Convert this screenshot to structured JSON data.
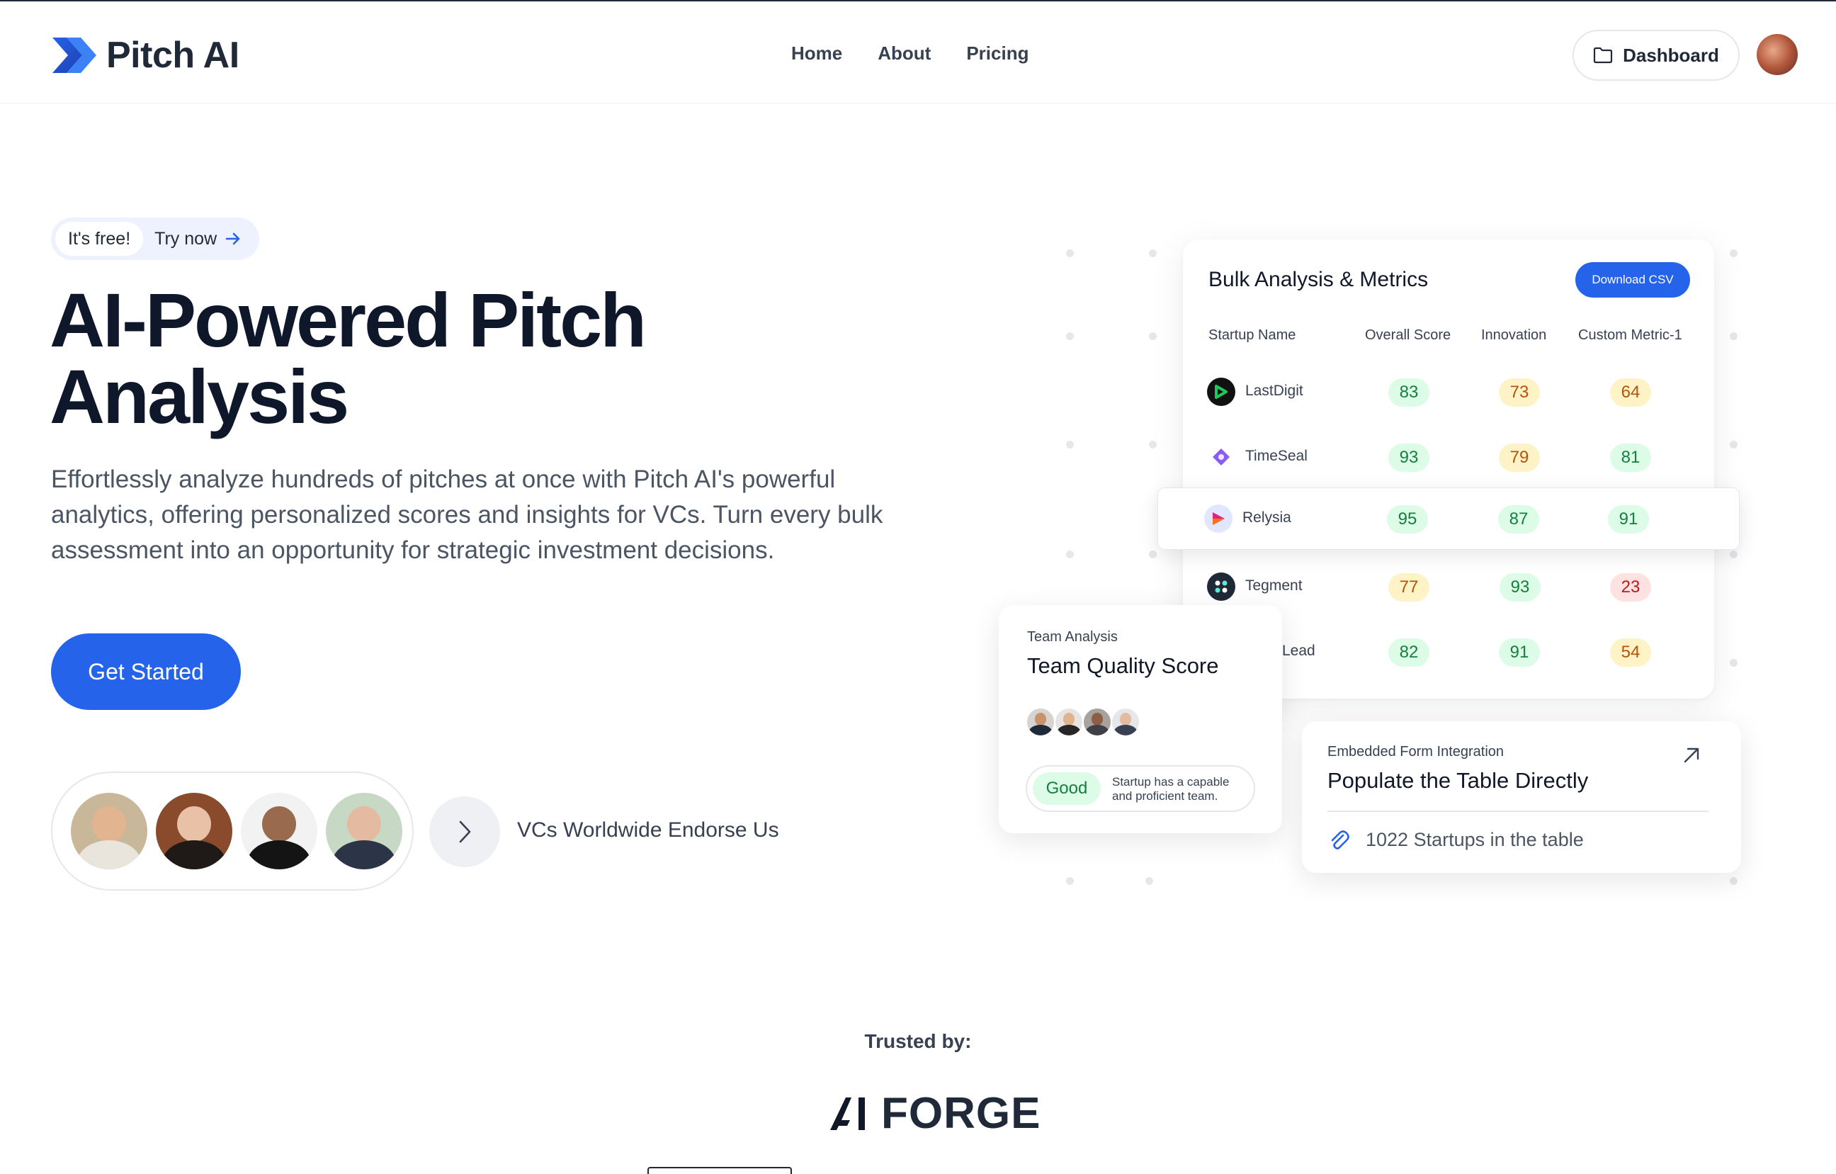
{
  "brand": {
    "name": "Pitch AI"
  },
  "nav": {
    "items": [
      "Home",
      "About",
      "Pricing"
    ],
    "dashboard": "Dashboard"
  },
  "hero": {
    "pill_free": "It's free!",
    "pill_try": "Try now",
    "title_line1": "AI-Powered Pitch",
    "title_line2": "Analysis",
    "description": "Effortlessly analyze hundreds of pitches at once with Pitch AI's powerful analytics, offering personalized scores and insights for VCs. Turn every bulk assessment into an opportunity for strategic investment decisions.",
    "cta": "Get Started",
    "endorse": "VCs Worldwide Endorse Us"
  },
  "metrics_card": {
    "title": "Bulk Analysis & Metrics",
    "download": "Download CSV",
    "columns": [
      "Startup Name",
      "Overall Score",
      "Innovation",
      "Custom Metric-1"
    ],
    "rows": [
      {
        "name": "LastDigit",
        "scores": [
          "83",
          "73",
          "64"
        ]
      },
      {
        "name": "TimeSeal",
        "scores": [
          "93",
          "79",
          "81"
        ]
      },
      {
        "name": "Relysia",
        "scores": [
          "95",
          "87",
          "91"
        ]
      },
      {
        "name": "Tegment",
        "scores": [
          "77",
          "93",
          "23"
        ]
      },
      {
        "name": "Lead",
        "scores": [
          "82",
          "91",
          "54"
        ]
      }
    ]
  },
  "team_card": {
    "eyebrow": "Team Analysis",
    "title": "Team Quality Score",
    "badge": "Good",
    "note_line1": "Startup has a capable",
    "note_line2": "and proficient team."
  },
  "form_card": {
    "eyebrow": "Embedded Form Integration",
    "title": "Populate the Table Directly",
    "count": "1022 Startups in the table"
  },
  "trusted": {
    "label": "Trusted by:",
    "logo_text": "FORGE"
  },
  "colors": {
    "accent": "#2563eb",
    "good": "#15803d",
    "warn": "#b45309",
    "bad": "#b91c1c"
  }
}
